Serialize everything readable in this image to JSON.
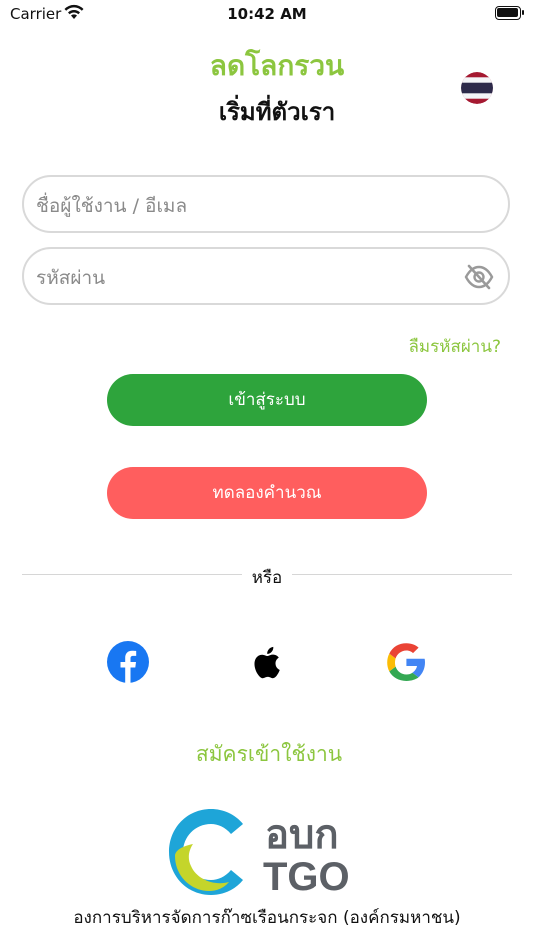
{
  "status_bar": {
    "carrier": "Carrier",
    "time": "10:42 AM"
  },
  "header": {
    "title": "ลดโลกรวน",
    "subtitle": "เริ่มที่ตัวเรา",
    "language_flag": "thailand-flag"
  },
  "login_form": {
    "username_placeholder": "ชื่อผู้ใช้งาน / อีเมล",
    "password_placeholder": "รหัสผ่าน",
    "forgot_password": "ลืมรหัสผ่าน?",
    "login_button": "เข้าสู่ระบบ",
    "trial_button": "ทดลองคำนวณ"
  },
  "divider_text": "หรือ",
  "social_login": [
    "facebook-icon",
    "apple-icon",
    "google-icon"
  ],
  "register_link": "สมัครเข้าใช้งาน",
  "footer": {
    "logo_text_top": "อบก",
    "logo_text_bottom": "TGO",
    "organization": "องการบริหารจัดการก๊าซเรือนกระจก (องค์กรมหาชน)"
  },
  "colors": {
    "brand_green": "#8cc63f",
    "login_green": "#2ea43c",
    "trial_red": "#ff5e5e"
  }
}
